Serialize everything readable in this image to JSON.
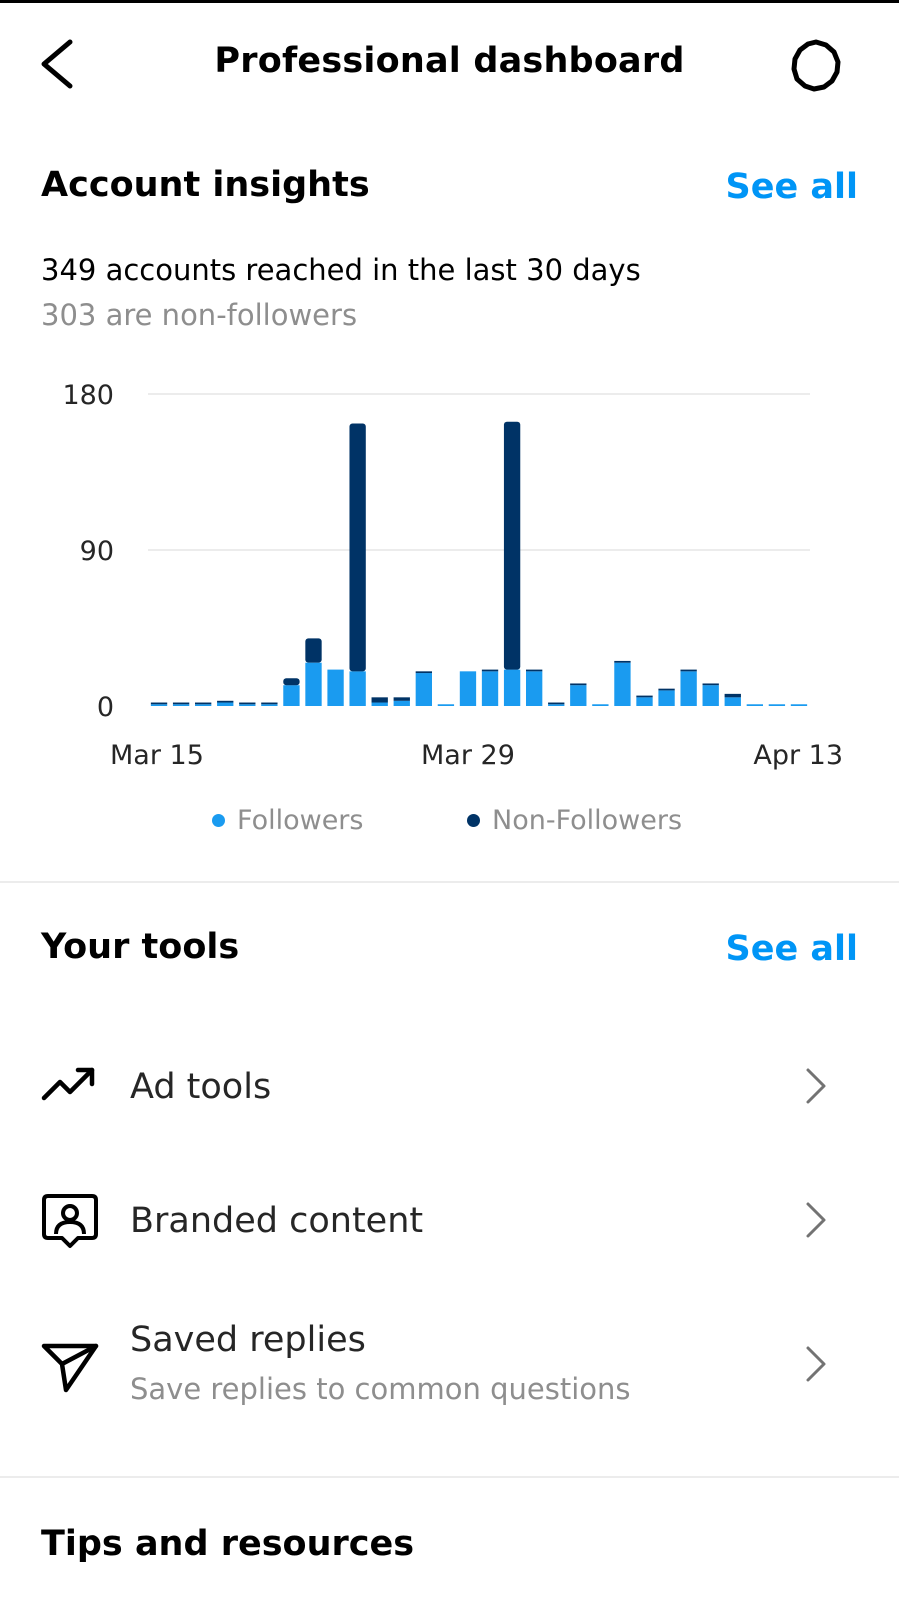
{
  "header": {
    "title": "Professional dashboard",
    "back_icon": "chevron-left-icon",
    "settings_icon": "gear-icon"
  },
  "insights": {
    "title": "Account insights",
    "see_all": "See all",
    "reach_text": "349 accounts reached in the last 30 days",
    "nonfollowers_text": "303 are non-followers"
  },
  "chart_data": {
    "type": "bar",
    "stacked": true,
    "categories": [
      "Mar 15",
      "Mar 16",
      "Mar 17",
      "Mar 18",
      "Mar 19",
      "Mar 20",
      "Mar 21",
      "Mar 22",
      "Mar 23",
      "Mar 24",
      "Mar 25",
      "Mar 26",
      "Mar 27",
      "Mar 28",
      "Mar 29",
      "Mar 30",
      "Mar 31",
      "Apr 1",
      "Apr 2",
      "Apr 3",
      "Apr 4",
      "Apr 5",
      "Apr 6",
      "Apr 7",
      "Apr 8",
      "Apr 9",
      "Apr 10",
      "Apr 11",
      "Apr 12",
      "Apr 13"
    ],
    "x_tick_labels": [
      "Mar 15",
      "Mar 29",
      "Apr 13"
    ],
    "y_ticks": [
      0,
      90,
      180
    ],
    "ylim": [
      0,
      180
    ],
    "grid": true,
    "series": [
      {
        "name": "Followers",
        "color": "#1a9bf0",
        "values": [
          1,
          1,
          1,
          2,
          1,
          1,
          12,
          25,
          21,
          20,
          2,
          3,
          19,
          1,
          20,
          20,
          21,
          20,
          1,
          12,
          1,
          25,
          5,
          9,
          20,
          12,
          5,
          1,
          1,
          1
        ]
      },
      {
        "name": "Non-Followers",
        "color": "#003366",
        "values": [
          1,
          1,
          1,
          1,
          1,
          1,
          4,
          14,
          0,
          143,
          3,
          2,
          1,
          0,
          0,
          1,
          143,
          1,
          1,
          1,
          0,
          1,
          1,
          1,
          1,
          1,
          2,
          0,
          0,
          0
        ]
      }
    ],
    "legend_position": "bottom"
  },
  "tools": {
    "title": "Your tools",
    "see_all": "See all",
    "items": [
      {
        "label": "Ad tools",
        "sub": "",
        "icon": "trending-up-icon"
      },
      {
        "label": "Branded content",
        "sub": "",
        "icon": "branded-content-icon"
      },
      {
        "label": "Saved replies",
        "sub": "Save replies to common questions",
        "icon": "send-icon"
      }
    ]
  },
  "tips": {
    "title": "Tips and resources"
  },
  "colors": {
    "accent": "#0095f6",
    "followers": "#1a9bf0",
    "non_followers": "#003366",
    "secondary_text": "#8e8e8e"
  }
}
